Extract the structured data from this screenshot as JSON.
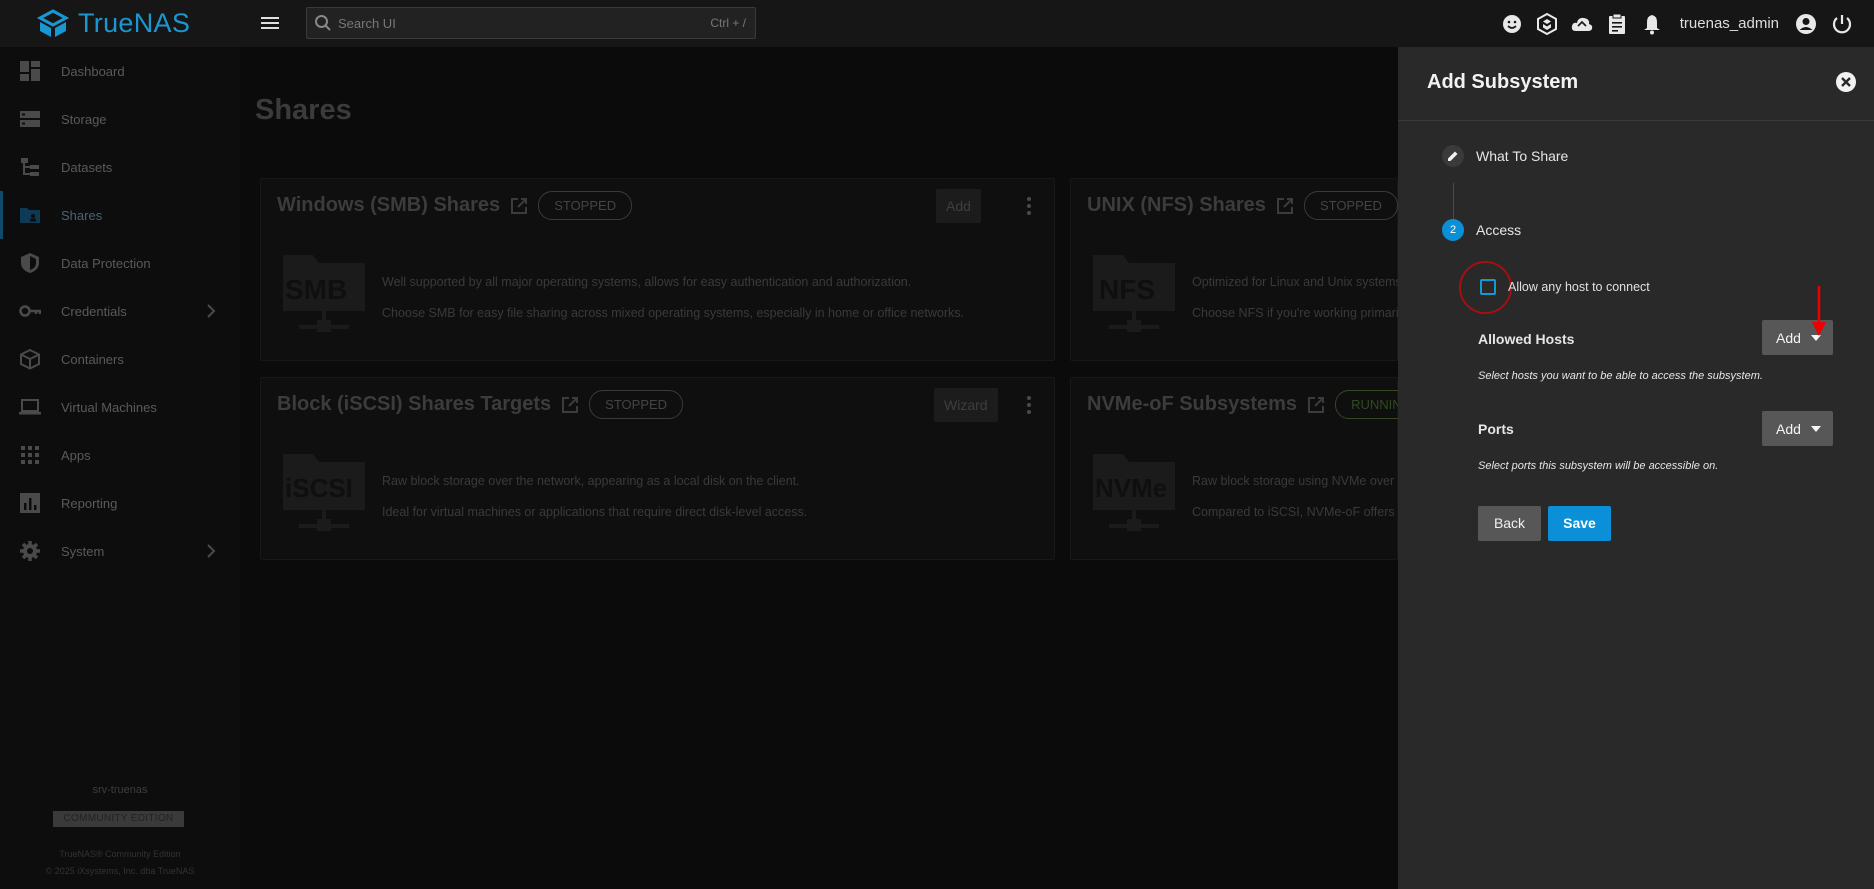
{
  "app": {
    "name": "TrueNAS"
  },
  "topbar": {
    "search_placeholder": "Search UI",
    "search_shortcut": "Ctrl + /",
    "username": "truenas_admin",
    "icons": [
      "feedback-icon",
      "truecommand-icon",
      "update-cloud-icon",
      "jobs-clipboard-icon",
      "notifications-bell-icon",
      "account-circle-icon",
      "power-icon"
    ]
  },
  "sidebar": {
    "items": [
      {
        "label": "Dashboard",
        "icon": "dashboard-icon"
      },
      {
        "label": "Storage",
        "icon": "storage-icon"
      },
      {
        "label": "Datasets",
        "icon": "datasets-icon"
      },
      {
        "label": "Shares",
        "icon": "shares-folder-icon",
        "active": true
      },
      {
        "label": "Data Protection",
        "icon": "shield-icon"
      },
      {
        "label": "Credentials",
        "icon": "key-icon",
        "has_children": true
      },
      {
        "label": "Containers",
        "icon": "cube-icon"
      },
      {
        "label": "Virtual Machines",
        "icon": "laptop-icon"
      },
      {
        "label": "Apps",
        "icon": "apps-grid-icon"
      },
      {
        "label": "Reporting",
        "icon": "bar-chart-icon"
      },
      {
        "label": "System",
        "icon": "gear-icon",
        "has_children": true
      }
    ],
    "hostname": "srv-truenas",
    "edition": "COMMUNITY EDITION",
    "copyright_line1": "TrueNAS® Community Edition",
    "copyright_line2": "© 2025 iXsystems, Inc. dba TrueNAS"
  },
  "main": {
    "title": "Shares",
    "cards": {
      "smb": {
        "title": "Windows (SMB) Shares",
        "status": "STOPPED",
        "action": "Add",
        "logo_text": "SMB",
        "desc1": "Well supported by all major operating systems, allows for easy authentication and authorization.",
        "desc2": "Choose SMB for easy file sharing across mixed operating systems, especially in home or office networks."
      },
      "nfs": {
        "title": "UNIX (NFS) Shares",
        "status": "STOPPED",
        "logo_text": "NFS",
        "desc1": "Optimized for Linux and Unix systems",
        "desc2": "Choose NFS if you're working primaril"
      },
      "iscsi": {
        "title": "Block (iSCSI) Shares Targets",
        "status": "STOPPED",
        "action": "Wizard",
        "logo_text": "iSCSI",
        "desc1": "Raw block storage over the network, appearing as a local disk on the client.",
        "desc2": "Ideal for virtual machines or applications that require direct disk-level access."
      },
      "nvme": {
        "title": "NVMe-oF Subsystems",
        "status": "RUNNIN",
        "logo_text": "NVMe",
        "desc1": "Raw block storage using NVMe over F",
        "desc2": "Compared to iSCSI, NVMe-oF offers s"
      }
    }
  },
  "drawer": {
    "title": "Add Subsystem",
    "steps": [
      {
        "label": "What To Share",
        "badge": ""
      },
      {
        "label": "Access",
        "badge": "2"
      }
    ],
    "allow_any_host_label": "Allow any host to connect",
    "allowed_hosts": {
      "label": "Allowed Hosts",
      "button": "Add",
      "help": "Select hosts you want to be able to access the subsystem."
    },
    "ports": {
      "label": "Ports",
      "button": "Add",
      "help": "Select ports this subsystem will be accessible on."
    },
    "back_label": "Back",
    "save_label": "Save",
    "colors": {
      "accent": "#0b8fd6",
      "annotation_red": "#a80e0e"
    }
  }
}
